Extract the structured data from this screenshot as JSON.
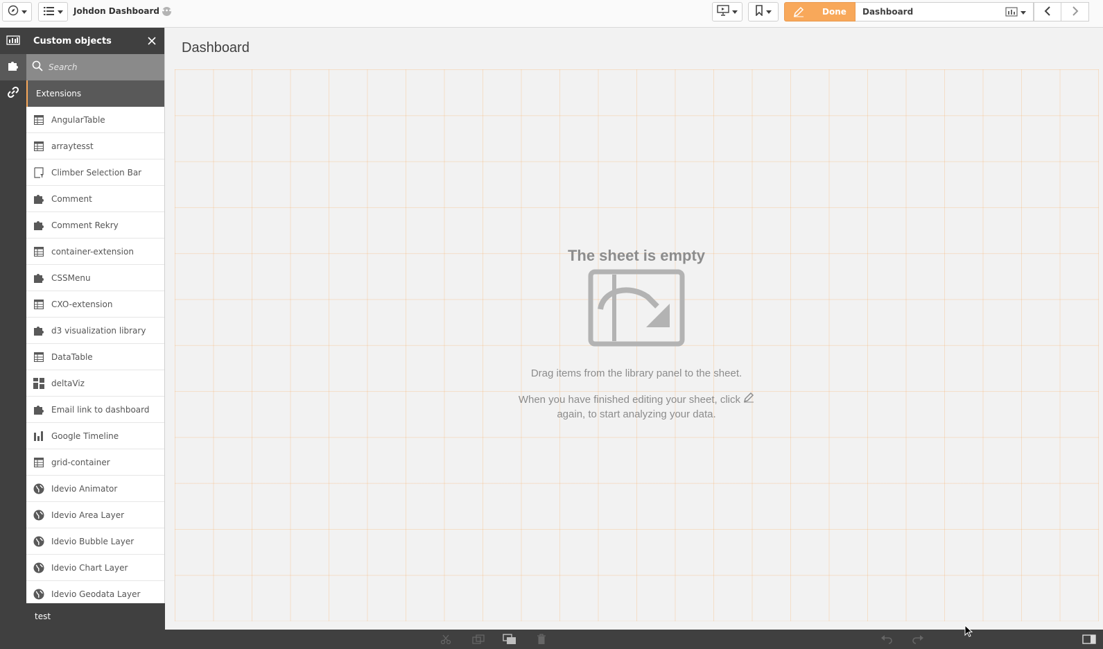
{
  "app": {
    "title": "Johdon Dashboard"
  },
  "toolbar": {
    "done_label": "Done",
    "sheet_name": "Dashboard"
  },
  "panel": {
    "title": "Custom objects",
    "search_placeholder": "Search",
    "section": "Extensions",
    "items": [
      {
        "label": "AngularTable",
        "icon": "table-icon"
      },
      {
        "label": "arraytesst",
        "icon": "table-icon"
      },
      {
        "label": "Climber Selection Bar",
        "icon": "filter-pane-icon"
      },
      {
        "label": "Comment",
        "icon": "puzzle-icon"
      },
      {
        "label": "Comment Rekry",
        "icon": "puzzle-icon"
      },
      {
        "label": "container-extension",
        "icon": "table-icon"
      },
      {
        "label": "CSSMenu",
        "icon": "puzzle-icon"
      },
      {
        "label": "CXO-extension",
        "icon": "table-icon"
      },
      {
        "label": "d3 visualization library",
        "icon": "puzzle-icon"
      },
      {
        "label": "DataTable",
        "icon": "table-icon"
      },
      {
        "label": "deltaViz",
        "icon": "dashboard-icon"
      },
      {
        "label": "Email link to dashboard",
        "icon": "puzzle-icon"
      },
      {
        "label": "Google Timeline",
        "icon": "bar-chart-icon"
      },
      {
        "label": "grid-container",
        "icon": "table-icon"
      },
      {
        "label": "Idevio Animator",
        "icon": "globe-icon"
      },
      {
        "label": "Idevio Area Layer",
        "icon": "globe-icon"
      },
      {
        "label": "Idevio Bubble Layer",
        "icon": "globe-icon"
      },
      {
        "label": "Idevio Chart Layer",
        "icon": "globe-icon"
      },
      {
        "label": "Idevio Geodata Layer",
        "icon": "globe-icon"
      }
    ],
    "footer_section": "test"
  },
  "sheet": {
    "title": "Dashboard",
    "empty_title": "The sheet is empty",
    "empty_line1": "Drag items from the library panel to the sheet.",
    "empty_line2a": "When you have finished editing your sheet, click",
    "empty_line2b": "again, to start analyzing your data."
  },
  "colors": {
    "accent": "#f8a85a",
    "rail": "#404040",
    "panel_search": "#8a8a8a"
  }
}
